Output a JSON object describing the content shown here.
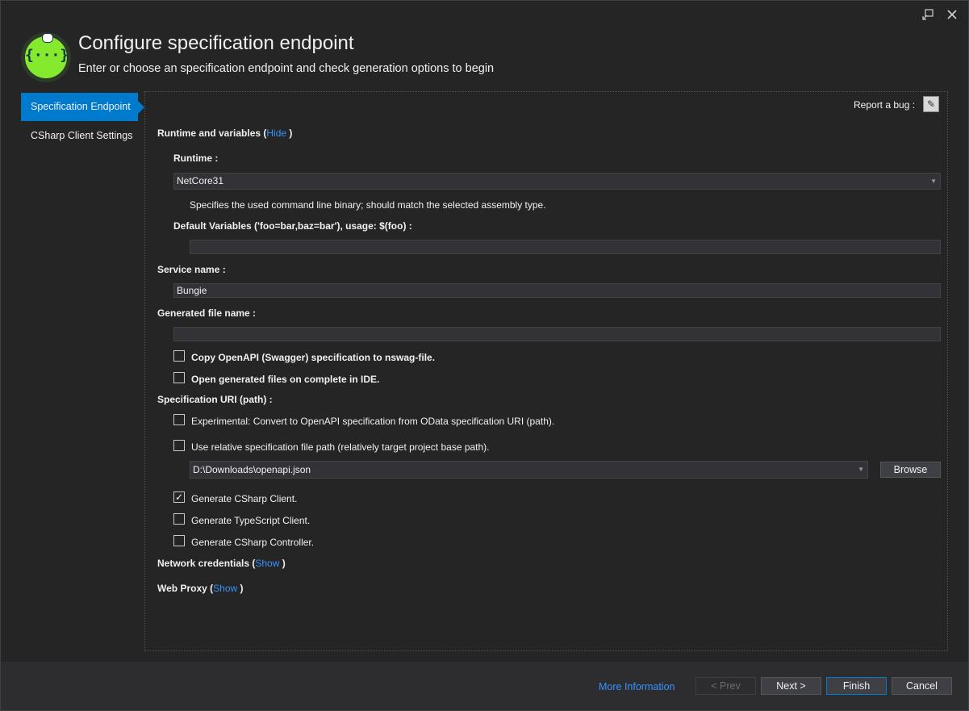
{
  "window": {
    "title": "Configure specification endpoint",
    "subtitle": "Enter or choose an specification endpoint and check generation options to begin",
    "restore_icon": "restore-icon",
    "close_icon": "close-icon"
  },
  "logo": {
    "glyph": "{···}",
    "name": "swagger-logo-icon"
  },
  "sidebar": {
    "items": [
      {
        "label": "Specification Endpoint",
        "active": true
      },
      {
        "label": "CSharp Client Settings",
        "active": false
      }
    ]
  },
  "report": {
    "label": "Report a bug :",
    "icon_glyph": "✎",
    "icon": "bug-report-icon"
  },
  "runtime_section": {
    "title": "Runtime and variables (",
    "toggle": "Hide",
    "close_paren": " )",
    "runtime_label": "Runtime :",
    "runtime_value": "NetCore31",
    "runtime_help": "Specifies the used command line binary; should match the selected assembly type.",
    "variables_label": "Default Variables ('foo=bar,baz=bar'), usage: $(foo) :",
    "variables_value": ""
  },
  "service": {
    "label": "Service name :",
    "value": "Bungie"
  },
  "generated_file": {
    "label": "Generated file name :",
    "value": ""
  },
  "options": {
    "copy_spec": {
      "label": "Copy OpenAPI (Swagger) specification to nswag-file.",
      "checked": false
    },
    "open_files": {
      "label": "Open generated files on complete in IDE.",
      "checked": false
    }
  },
  "spec_uri": {
    "label": "Specification URI (path) :",
    "odata": {
      "label": "Experimental: Convert to OpenAPI specification from OData specification URI (path).",
      "checked": false
    },
    "relative": {
      "label": "Use relative specification file path (relatively target project base path).",
      "checked": false
    },
    "path_value": "D:\\Downloads\\openapi.json",
    "browse_label": "Browse"
  },
  "generate": {
    "csharp_client": {
      "label": "Generate CSharp Client.",
      "checked": true,
      "mark": "✓"
    },
    "typescript_client": {
      "label": "Generate TypeScript Client.",
      "checked": false
    },
    "csharp_controller": {
      "label": "Generate CSharp Controller.",
      "checked": false
    }
  },
  "network": {
    "label": "Network credentials (",
    "toggle": "Show",
    "close_paren": " )"
  },
  "proxy": {
    "label": "Web Proxy (",
    "toggle": "Show",
    "close_paren": " )"
  },
  "footer": {
    "more_info": "More Information",
    "prev": "< Prev",
    "next": "Next >",
    "finish": "Finish",
    "cancel": "Cancel"
  },
  "colors": {
    "accent": "#007acc",
    "link": "#3794ff",
    "logo_green": "#85ea2d",
    "background": "#252526"
  }
}
